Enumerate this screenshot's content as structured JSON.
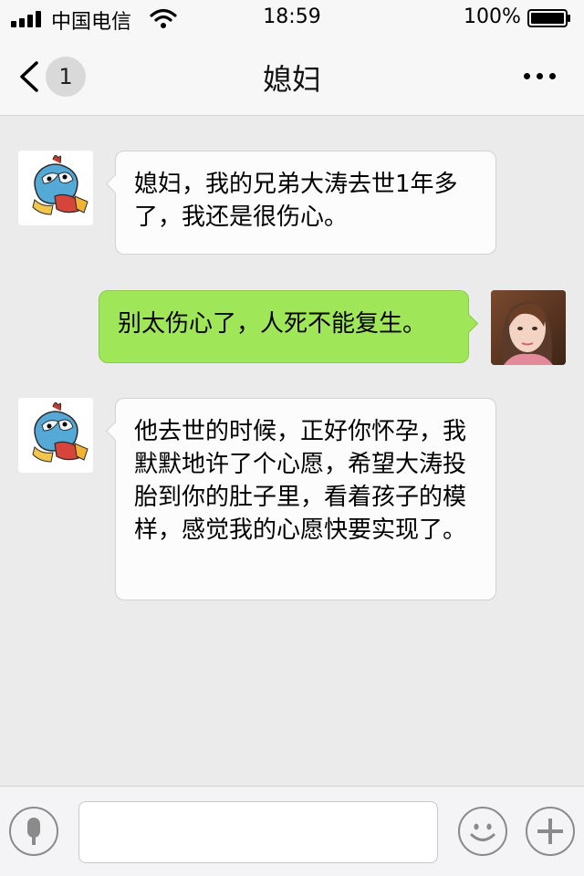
{
  "status_bar": {
    "carrier": "中国电信",
    "time": "18:59",
    "battery": "100%"
  },
  "header": {
    "back_badge": "1",
    "title": "媳妇"
  },
  "messages": [
    {
      "direction": "incoming",
      "sender": "contact",
      "text": "媳妇，我的兄弟大涛去世1年多了，我还是很伤心。"
    },
    {
      "direction": "outgoing",
      "sender": "me",
      "text": "别太伤心了，人死不能复生。"
    },
    {
      "direction": "incoming",
      "sender": "contact",
      "text": "他去世的时候，正好你怀孕，我默默地许了个心愿，希望大涛投胎到你的肚子里，看着孩子的模样，感觉我的心愿快要实现了。"
    }
  ],
  "input_bar": {
    "value": "",
    "icons": [
      "microphone-icon",
      "emoji-icon",
      "plus-icon"
    ]
  },
  "colors": {
    "outgoing_bubble": "#9fe659",
    "incoming_bubble": "#fcfcfc",
    "background": "#ebebeb"
  }
}
